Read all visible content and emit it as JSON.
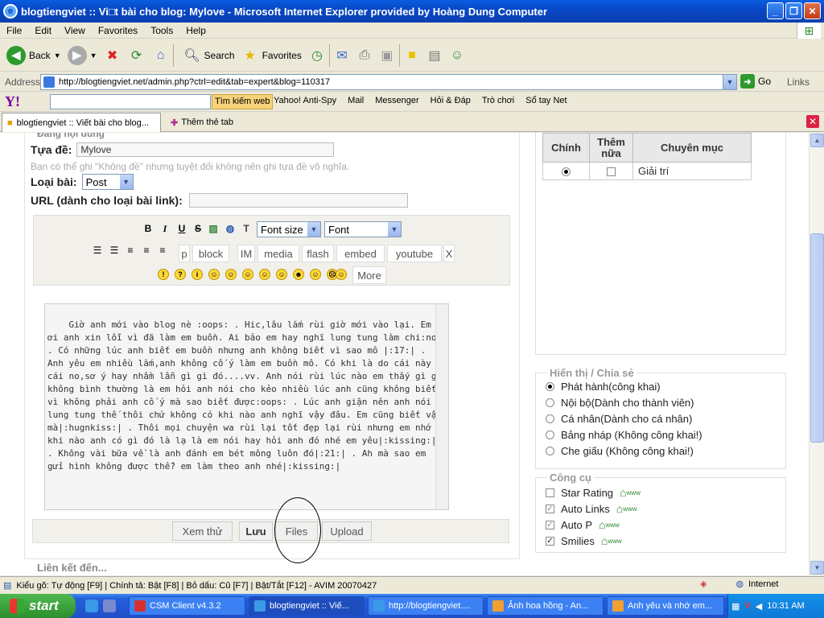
{
  "window": {
    "title": "blogtiengviet :: Vi□t bài cho blog: Mylove - Microsoft Internet Explorer provided by Hoàng Dung Computer"
  },
  "menubar": [
    "File",
    "Edit",
    "View",
    "Favorites",
    "Tools",
    "Help"
  ],
  "toolbar": {
    "back": "Back",
    "search": "Search",
    "favorites": "Favorites"
  },
  "address": {
    "label": "Address",
    "url": "http://blogtiengviet.net/admin.php?ctrl=edit&tab=expert&blog=110317",
    "go": "Go",
    "links": "Links"
  },
  "yahoo": {
    "search_label": "Tìm kiếm web",
    "items": [
      "Yahoo! Anti-Spy",
      "Mail",
      "Messenger",
      "Hỏi & Đáp",
      "Trò chơi",
      "Sổ tay Net"
    ]
  },
  "tabs": {
    "active": "blogtiengviet :: Viết bài cho blog...",
    "new": "Thêm thẻ tab"
  },
  "form": {
    "legend_cut": "Đăng nội dung",
    "title_label": "Tựa đề:",
    "title_value": "Mylove",
    "hint": "Bạn có thể ghi \"Không đề\" nhưng tuyệt đối không nên ghi tựa đề vô nghĩa.",
    "type_label": "Loại bài:",
    "type_value": "Post",
    "url_label": "URL (dành cho loại bài link):"
  },
  "editor": {
    "bold": "B",
    "italic": "I",
    "underline": "U",
    "strike": "S",
    "font_size": "Font size",
    "font": "Font",
    "pills": [
      "p",
      "block",
      "IM",
      "media",
      "flash",
      "embed",
      "youtube",
      "X"
    ],
    "more": "More",
    "body": "Giờ anh mới vào blog nè :oops: . Hic,lâu lắm rùi giờ mới vào lại. Em ơi anh xin lỗi vì đã làm em buồn. Ai bảo em hay nghĩ lung tung làm chi:no: . Có những lúc anh biết em buồn nhưng anh không biết vì sao mô |:17:| . Anh yêu em nhiều lắm,anh không cố ý làm em buồn mô. Có khi là do cái này cái no,sơ ý hay nhầm lẫn gì gì đó....vv. Anh nói rùi lúc nào em thấy gì gì không bình thường là em hỏi anh nói cho kẻo nhiều lúc anh cũng không biết vì không phải anh cố ý mà sao biết được:oops: . Lúc anh giận nên anh nói lung tung thế thôi chứ không có khi nào anh nghĩ vậy đâu. Em cũng biết vậy mà|:hugnkiss:| . Thôi mọi chuyện wa rùi lại tốt đẹp lại rùi nhưng em nhớ khi nào anh có gì đó là lạ là em nói hay hỏi anh đó nhé em yêu|:kissing:| . Không vài bữa về là anh đánh em bét mông luôn đó|:21:| . Ah mà sao em gửi hình không được thế? em làm theo anh nhé|:kissing:|"
  },
  "buttons": {
    "preview": "Xem thử",
    "save": "Lưu",
    "files": "Files",
    "upload": "Upload"
  },
  "links_label": "Liên kết đến...",
  "category": {
    "headers": [
      "Chính",
      "Thêm nữa",
      "Chuyên mục"
    ],
    "row": "Giải trí"
  },
  "visibility": {
    "title": "Hiển thị / Chia sẻ",
    "options": [
      "Phát hành(công khai)",
      "Nội bộ(Dành cho thành viên)",
      "Cá nhân(Dành cho cá nhân)",
      "Bảng nháp (Không công khai!)",
      "Che giấu (Không công khai!)"
    ]
  },
  "tools": {
    "title": "Công cụ",
    "options": [
      "Star Rating",
      "Auto Links",
      "Auto P",
      "Smilies"
    ],
    "www": "www"
  },
  "status": {
    "text": "Kiểu gõ: Tự động [F9] | Chính tả: Bật [F8] | Bỏ dấu: Cũ [F7] | Bật/Tắt [F12] - AVIM 20070427",
    "zone": "Internet"
  },
  "taskbar": {
    "start": "start",
    "tasks": [
      "CSM Client v4.3.2",
      "blogtiengviet :: Viế...",
      "http://blogtiengviet....",
      "Ảnh hoa hồng - An...",
      "Anh yêu và nhớ em..."
    ],
    "clock": "10:31 AM"
  }
}
